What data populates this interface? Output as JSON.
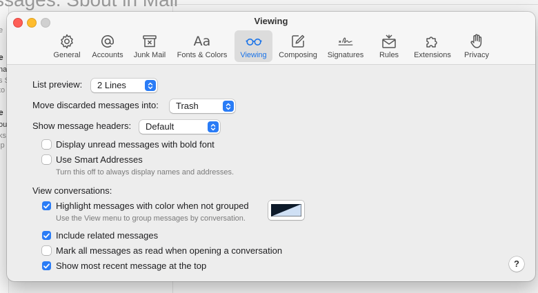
{
  "background": {
    "title_fragment": "ssages: Sbout in Mail",
    "fragments": [
      {
        "text": "e",
        "style": "b"
      },
      {
        "text": "na",
        "style": ""
      },
      {
        "text": "s S",
        "style": "g"
      },
      {
        "text": "to",
        "style": "g"
      },
      {
        "text": "d",
        "style": "g"
      },
      {
        "text": "e",
        "style": "b"
      },
      {
        "text": "ou",
        "style": ""
      },
      {
        "text": "ks",
        "style": "g"
      },
      {
        "text": "lp",
        "style": "g"
      },
      {
        "text": "e",
        "style": "g"
      }
    ]
  },
  "window": {
    "title": "Viewing"
  },
  "toolbar": {
    "items": [
      {
        "label": "General",
        "icon": "gear-icon",
        "active": false
      },
      {
        "label": "Accounts",
        "icon": "at-sign-icon",
        "active": false
      },
      {
        "label": "Junk Mail",
        "icon": "junk-trash-icon",
        "active": false
      },
      {
        "label": "Fonts & Colors",
        "icon": "font-aa-icon",
        "active": false
      },
      {
        "label": "Viewing",
        "icon": "glasses-icon",
        "active": true
      },
      {
        "label": "Composing",
        "icon": "pencil-square-icon",
        "active": false
      },
      {
        "label": "Signatures",
        "icon": "signature-icon",
        "active": false
      },
      {
        "label": "Rules",
        "icon": "envelope-rules-icon",
        "active": false
      },
      {
        "label": "Extensions",
        "icon": "puzzle-piece-icon",
        "active": false
      },
      {
        "label": "Privacy",
        "icon": "hand-icon",
        "active": false
      }
    ]
  },
  "settings": {
    "list_preview_label": "List preview:",
    "list_preview_value": "2 Lines",
    "move_discarded_label": "Move discarded messages into:",
    "move_discarded_value": "Trash",
    "show_headers_label": "Show message headers:",
    "show_headers_value": "Default",
    "bold_unread_label": "Display unread messages with bold font",
    "bold_unread_checked": false,
    "smart_addresses_label": "Use Smart Addresses",
    "smart_addresses_checked": false,
    "smart_addresses_hint": "Turn this off to always display names and addresses.",
    "view_conversations_label": "View conversations:",
    "highlight_label": "Highlight messages with color when not grouped",
    "highlight_checked": true,
    "highlight_hint": "Use the View menu to group messages by conversation.",
    "highlight_color": "#cfe0f5",
    "include_related_label": "Include related messages",
    "include_related_checked": true,
    "mark_read_label": "Mark all messages as read when opening a conversation",
    "mark_read_checked": false,
    "recent_top_label": "Show most recent message at the top",
    "recent_top_checked": true,
    "help_label": "?"
  },
  "colors": {
    "accent": "#2a7cf6",
    "close": "#fe5f57",
    "minimize": "#febc2e",
    "zoom_inactive": "#d0d0d0"
  }
}
